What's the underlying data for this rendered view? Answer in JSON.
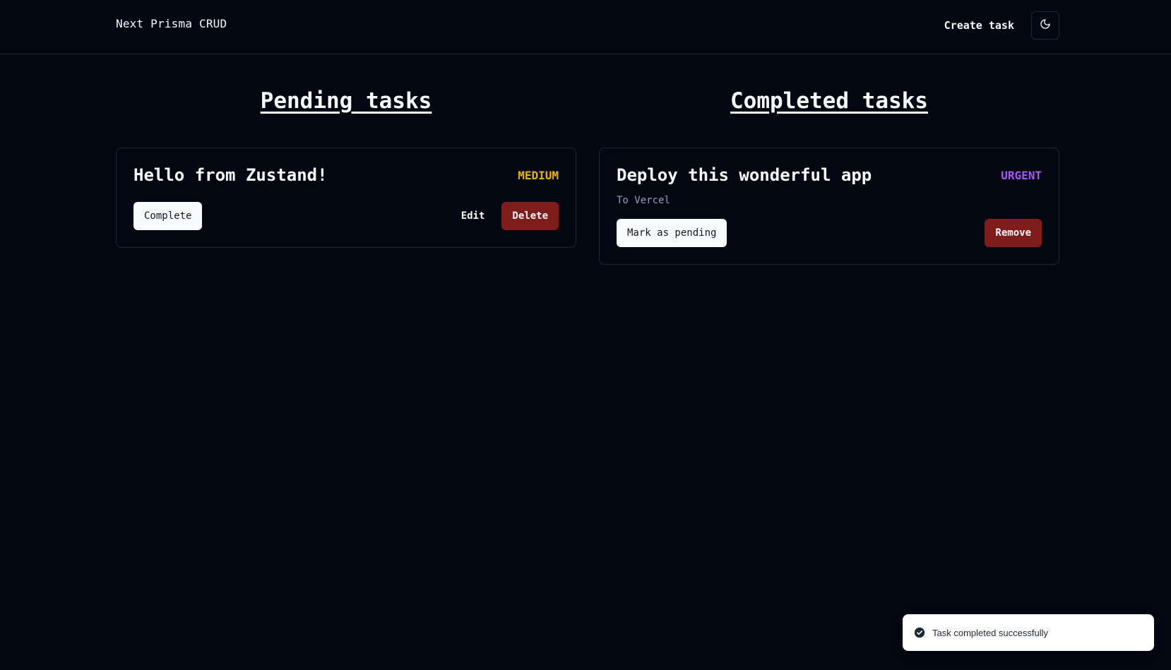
{
  "navbar": {
    "brand": "Next Prisma CRUD",
    "create_label": "Create task",
    "theme_icon": "moon-icon"
  },
  "pending": {
    "title": "Pending tasks",
    "tasks": [
      {
        "title": "Hello from Zustand!",
        "priority": "MEDIUM",
        "priority_color": "#eab308",
        "complete_label": "Complete",
        "edit_label": "Edit",
        "delete_label": "Delete"
      }
    ]
  },
  "completed": {
    "title": "Completed tasks",
    "tasks": [
      {
        "title": "Deploy this wonderful app",
        "priority": "URGENT",
        "priority_color": "#a855f7",
        "description": "To Vercel",
        "pending_label": "Mark as pending",
        "remove_label": "Remove"
      }
    ]
  },
  "toast": {
    "icon": "check-circle-icon",
    "message": "Task completed successfully"
  },
  "colors": {
    "background": "#030711",
    "border": "#1e293b",
    "danger": "#7f1d1d"
  }
}
